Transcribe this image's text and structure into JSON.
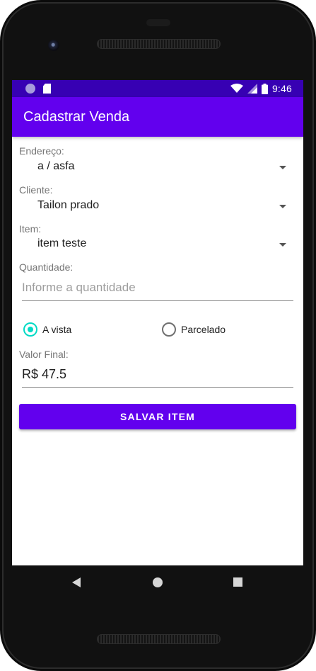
{
  "status_bar": {
    "time": "9:46",
    "left_icons": [
      "circle-notification-icon",
      "sd-card-icon"
    ],
    "right_icons": [
      "wifi-icon",
      "signal-icon",
      "battery-icon"
    ]
  },
  "app_bar": {
    "title": "Cadastrar Venda"
  },
  "form": {
    "endereco": {
      "label": "Endereço:",
      "value": "a / asfa"
    },
    "cliente": {
      "label": "Cliente:",
      "value": "Tailon prado"
    },
    "item": {
      "label": "Item:",
      "value": "item teste"
    },
    "quantidade": {
      "label": "Quantidade:",
      "placeholder": "Informe a quantidade",
      "value": ""
    },
    "payment": {
      "options": [
        {
          "label": "A vista",
          "checked": true
        },
        {
          "label": "Parcelado",
          "checked": false
        }
      ]
    },
    "valor_final": {
      "label": "Valor Final:",
      "value": "R$ 47.5"
    },
    "save_button": "SALVAR ITEM"
  },
  "colors": {
    "status_bar": "#3700b3",
    "primary": "#6200ee",
    "accent": "#03dac5"
  },
  "nav_bar": {
    "icons": [
      "back-icon",
      "home-icon",
      "recent-apps-icon"
    ]
  }
}
